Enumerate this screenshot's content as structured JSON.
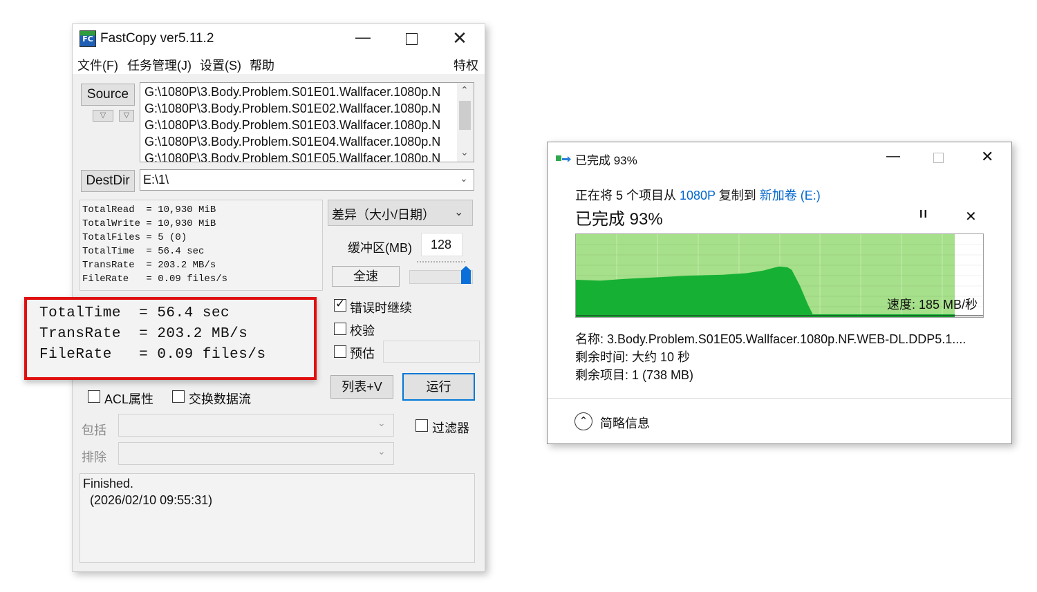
{
  "fastcopy": {
    "title": "FastCopy ver5.11.2",
    "menu": [
      "文件(F)",
      "任务管理(J)",
      "设置(S)",
      "帮助"
    ],
    "menu_right": "特权",
    "source_button": "Source",
    "source_files": [
      "G:\\1080P\\3.Body.Problem.S01E01.Wallfacer.1080p.N",
      "G:\\1080P\\3.Body.Problem.S01E02.Wallfacer.1080p.N",
      "G:\\1080P\\3.Body.Problem.S01E03.Wallfacer.1080p.N",
      "G:\\1080P\\3.Body.Problem.S01E04.Wallfacer.1080p.N",
      "G:\\1080P\\3.Body.Problem.S01E05.Wallfacer.1080p.N"
    ],
    "destdir_button": "DestDir",
    "destdir_value": "E:\\1\\",
    "stats": [
      "TotalRead  = 10,930 MiB",
      "TotalWrite = 10,930 MiB",
      "TotalFiles = 5 (0)",
      "TotalTime  = 56.4 sec",
      "TransRate  = 203.2 MB/s",
      "FileRate   = 0.09 files/s"
    ],
    "mode_select": "差异（大小/日期）",
    "buffer_label": "缓冲区(MB)",
    "buffer_value": "128",
    "speed_button": "全速",
    "speed_level": 1.0,
    "options": {
      "continue_on_error": {
        "label": "错误时继续",
        "checked": true
      },
      "verify": {
        "label": "校验",
        "checked": false
      },
      "estimate": {
        "label": "预估",
        "checked": false
      },
      "acl": {
        "label": "ACL属性",
        "checked": false
      },
      "alt_stream": {
        "label": "交换数据流",
        "checked": false
      },
      "filter": {
        "label": "过滤器",
        "checked": false
      }
    },
    "list_button": "列表+V",
    "run_button": "运行",
    "include_label": "包括",
    "exclude_label": "排除",
    "log_lines": [
      "Finished.",
      "  (2026/02/10 09:55:31)"
    ]
  },
  "highlight": {
    "lines": [
      "TotalTime  = 56.4 sec",
      "TransRate  = 203.2 MB/s",
      "FileRate   = 0.09 files/s"
    ],
    "color": "#e01010"
  },
  "copy_dialog": {
    "title": "已完成 93%",
    "status_prefix": "正在将 5 个项目从 ",
    "source_link": "1080P",
    "status_middle": " 复制到 ",
    "dest_link": "新加卷 (E:)",
    "heading": "已完成 93%",
    "progress": 0.93,
    "speed_label": "速度: 185 MB/秒",
    "name_line": "名称:  3.Body.Problem.S01E05.Wallfacer.1080p.NF.WEB-DL.DDP5.1....",
    "time_line": "剩余时间:  大约 10 秒",
    "items_line": "剩余项目:  1 (738 MB)",
    "details_toggle": "简略信息",
    "graph_fill_color": "#a6e08a",
    "graph_speed_color": "#16b034"
  }
}
